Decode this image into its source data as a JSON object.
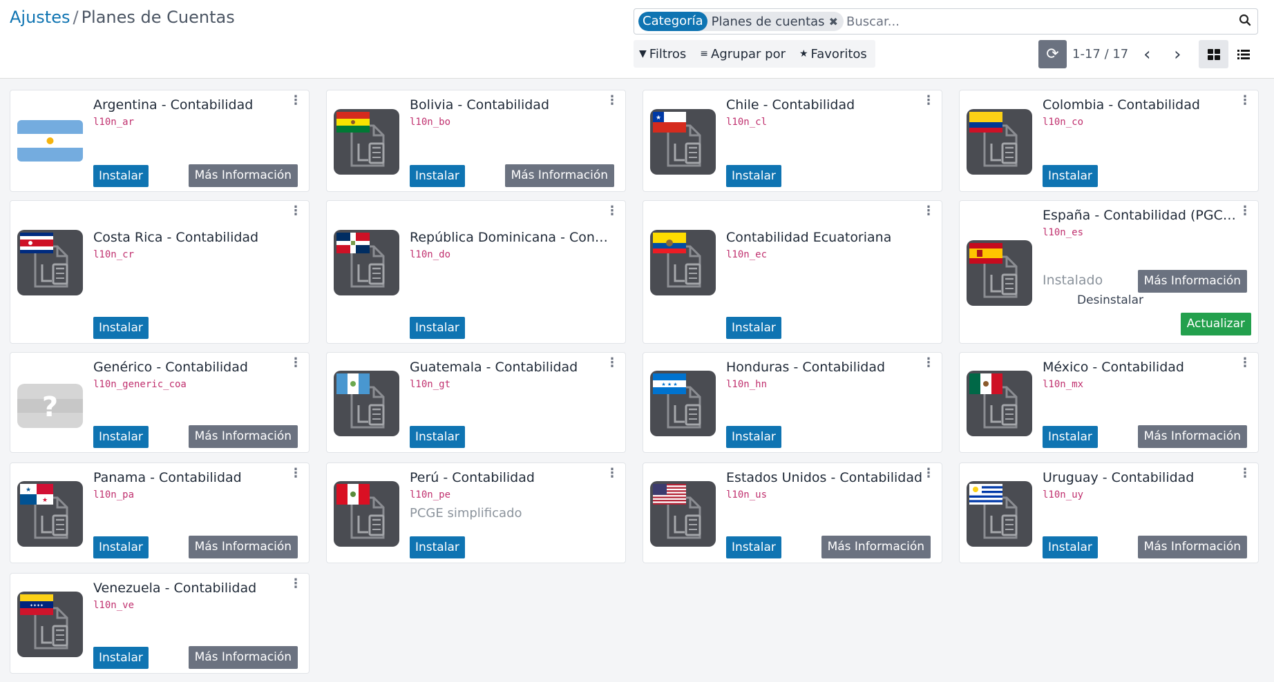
{
  "breadcrumb": {
    "parent": "Ajustes",
    "separator": "/",
    "current": "Planes de Cuentas"
  },
  "search": {
    "facet_label": "Categoría",
    "facet_value": "Planes de cuentas",
    "facet_remove_icon": "close-icon",
    "placeholder": "Buscar...",
    "search_icon": "search-icon"
  },
  "filters": {
    "filters_label": "Filtros",
    "groupby_label": "Agrupar por",
    "favorites_label": "Favoritos"
  },
  "pager": {
    "value": "1-17 / 17"
  },
  "views": {
    "active": "kanban"
  },
  "cards": [
    {
      "title": "Argentina - Contabilidad",
      "tech": "l10n_ar",
      "install": "Instalar",
      "more": "Más Información",
      "flag": "ar"
    },
    {
      "title": "Bolivia - Contabilidad",
      "tech": "l10n_bo",
      "install": "Instalar",
      "more": "Más Información",
      "flag": "bo"
    },
    {
      "title": "Chile - Contabilidad",
      "tech": "l10n_cl",
      "install": "Instalar",
      "flag": "cl"
    },
    {
      "title": "Colombia - Contabilidad",
      "tech": "l10n_co",
      "install": "Instalar",
      "flag": "co"
    },
    {
      "title": "Costa Rica - Contabilidad",
      "tech": "l10n_cr",
      "install": "Instalar",
      "flag": "cr"
    },
    {
      "title": "República Dominicana - Cont...",
      "tech": "l10n_do",
      "install": "Instalar",
      "flag": "do"
    },
    {
      "title": "Contabilidad Ecuatoriana",
      "tech": "l10n_ec",
      "install": "Instalar",
      "flag": "ec"
    },
    {
      "title": "España - Contabilidad (PGCE ...",
      "tech": "l10n_es",
      "installed": "Instalado",
      "more": "Más Información",
      "uninstall": "Desinstalar",
      "update": "Actualizar",
      "flag": "es"
    },
    {
      "title": "Genérico - Contabilidad",
      "tech": "l10n_generic_coa",
      "install": "Instalar",
      "more": "Más Información",
      "flag": "generic"
    },
    {
      "title": "Guatemala - Contabilidad",
      "tech": "l10n_gt",
      "install": "Instalar",
      "flag": "gt"
    },
    {
      "title": "Honduras - Contabilidad",
      "tech": "l10n_hn",
      "install": "Instalar",
      "flag": "hn"
    },
    {
      "title": "México - Contabilidad",
      "tech": "l10n_mx",
      "install": "Instalar",
      "more": "Más Información",
      "flag": "mx"
    },
    {
      "title": "Panama - Contabilidad",
      "tech": "l10n_pa",
      "install": "Instalar",
      "more": "Más Información",
      "flag": "pa"
    },
    {
      "title": "Perú - Contabilidad",
      "tech": "l10n_pe",
      "summary": "PCGE simplificado",
      "install": "Instalar",
      "flag": "pe"
    },
    {
      "title": "Estados Unidos - Contabilidad",
      "tech": "l10n_us",
      "install": "Instalar",
      "more": "Más Información",
      "flag": "us"
    },
    {
      "title": "Uruguay - Contabilidad",
      "tech": "l10n_uy",
      "install": "Instalar",
      "more": "Más Información",
      "flag": "uy"
    },
    {
      "title": "Venezuela - Contabilidad",
      "tech": "l10n_ve",
      "install": "Instalar",
      "more": "Más Información",
      "flag": "ve"
    }
  ],
  "colors": {
    "primary": "#0f74b2",
    "secondary": "#6b7280",
    "success": "#23a04d",
    "tech": "#c0306e"
  }
}
